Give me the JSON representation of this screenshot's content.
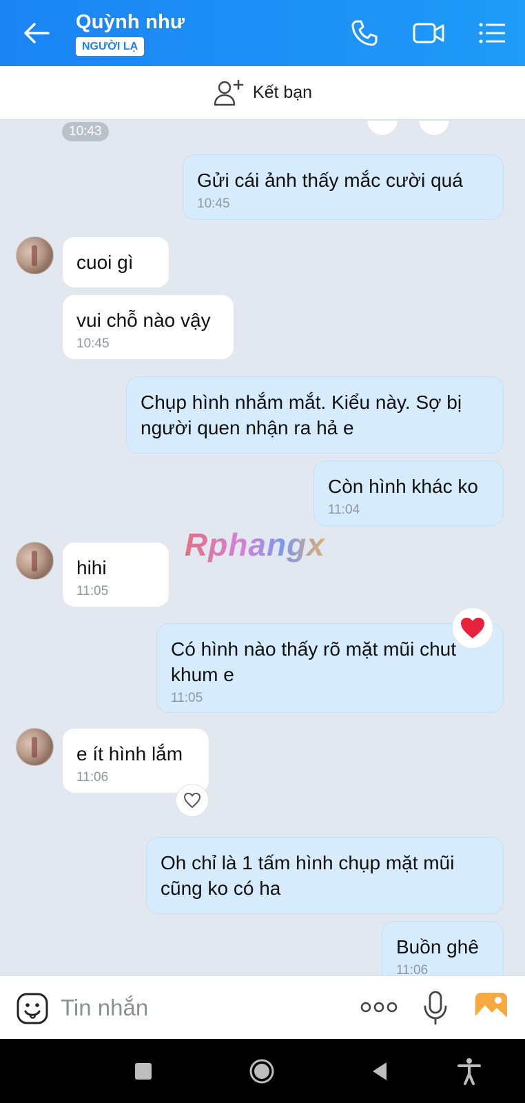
{
  "header": {
    "contact_name": "Quỳnh như",
    "badge": "NGƯỜI LẠ",
    "icons": [
      "arrow-left-icon",
      "phone-icon",
      "video-camera-icon",
      "list-menu-icon"
    ]
  },
  "friend_bar": {
    "label": "Kết bạn",
    "icon": "add-user-icon"
  },
  "chat": {
    "date_pill": "10:43",
    "messages": [
      {
        "from": "me",
        "text": "Gửi cái ảnh thấy mắc cười quá",
        "time": "10:45"
      },
      {
        "from": "them",
        "text": "cuoi gì",
        "time": ""
      },
      {
        "from": "them",
        "text": "vui chỗ nào vậy",
        "time": "10:45"
      },
      {
        "from": "me",
        "text": "Chụp hình nhắm mắt. Kiểu này. Sợ bị người quen nhận ra hả e",
        "time": ""
      },
      {
        "from": "me",
        "text": "Còn hình khác ko",
        "time": "11:04"
      },
      {
        "from": "them",
        "text": "hihi",
        "time": "11:05"
      },
      {
        "from": "me",
        "text": "Có hình nào thấy rõ mặt mũi chut khum e",
        "time": "11:05",
        "reaction": "red-heart-icon"
      },
      {
        "from": "them",
        "text": "e ít hình lắm",
        "time": "11:06",
        "reaction": "heart-outline-icon"
      },
      {
        "from": "me",
        "text": "Oh chỉ là 1 tấm hình chụp mặt mũi cũng ko có ha",
        "time": ""
      },
      {
        "from": "me",
        "text": "Buồn ghê",
        "time": "11:06"
      }
    ]
  },
  "watermark": "Rphangx",
  "input_bar": {
    "placeholder": "Tin nhắn",
    "icons": [
      "sticker-smile-icon",
      "more-dots-icon",
      "microphone-icon",
      "image-gallery-icon"
    ]
  },
  "nav_bar": {
    "icons": [
      "recent-apps-icon",
      "home-icon",
      "back-icon",
      "accessibility-icon"
    ]
  },
  "colors": {
    "header_blue": "#1a84f3",
    "my_bubble": "#d6ebfb",
    "their_bubble": "#ffffff",
    "chat_bg": "#e2e8ef"
  }
}
